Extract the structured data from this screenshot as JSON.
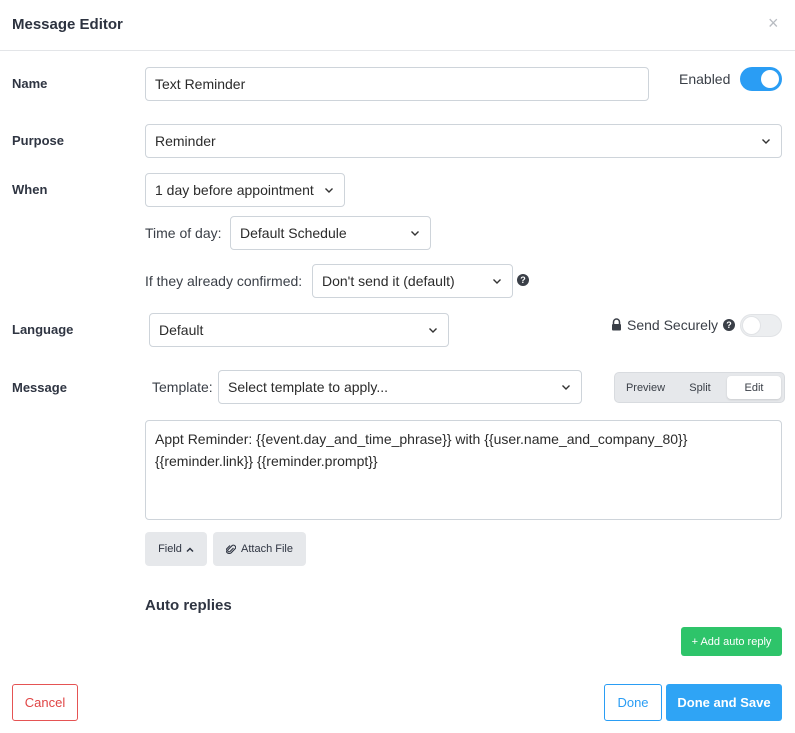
{
  "dialog": {
    "title": "Message Editor",
    "close_glyph": "×"
  },
  "name": {
    "label": "Name",
    "value": "Text Reminder",
    "enabled_label": "Enabled",
    "enabled": true
  },
  "purpose": {
    "label": "Purpose",
    "value": "Reminder"
  },
  "when": {
    "label": "When",
    "value": "1 day before appointment",
    "time_of_day_label": "Time of day:",
    "time_of_day_value": "Default Schedule",
    "confirmed_label": "If they already confirmed:",
    "confirmed_value": "Don't send it (default)"
  },
  "language": {
    "label": "Language",
    "value": "Default",
    "send_securely_label": "Send Securely",
    "send_securely": false
  },
  "message": {
    "label": "Message",
    "template_label": "Template:",
    "template_placeholder": "Select template to apply...",
    "modes": [
      "Preview",
      "Split",
      "Edit"
    ],
    "active_mode": "Edit",
    "body_line1": "Appt Reminder: {{event.day_and_time_phrase}} with {{user.name_and_company_80}}",
    "body_line2": "{{reminder.link}} {{reminder.prompt}}",
    "field_button": "Field",
    "attach_button": "Attach File"
  },
  "auto_replies": {
    "title": "Auto replies",
    "add_button": "+ Add auto reply"
  },
  "footer": {
    "cancel": "Cancel",
    "done": "Done",
    "done_and_save": "Done and Save"
  },
  "colors": {
    "accent": "#2fa4f5",
    "success": "#2ec46a",
    "danger": "#e55353"
  },
  "icons": {
    "close": "close-icon",
    "chevron": "chevron-down-icon",
    "help": "help-icon",
    "lock": "lock-icon",
    "paperclip": "paperclip-icon",
    "caret_up": "caret-up-icon"
  }
}
